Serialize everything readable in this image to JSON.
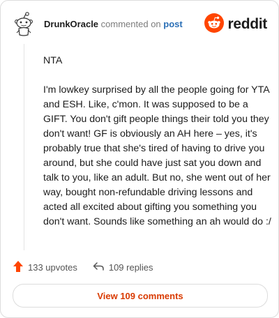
{
  "header": {
    "username": "DrunkOracle",
    "action_text": "commented on",
    "post_link": "post",
    "brand": "reddit"
  },
  "comment": {
    "paragraphs": [
      "NTA",
      "I'm lowkey surprised by all the people going for YTA and ESH. Like, c'mon. It was supposed to be a GIFT. You don't gift people things their told you they don't want! GF is obviously an AH here – yes, it's probably true that she's tired of having to drive you around, but she could have just sat you down and talk to you, like an adult. But no, she went out of her way, bought non-refundable driving lessons and acted all excited about gifting you something you don't want. Sounds like something an ah would do :/"
    ]
  },
  "actions": {
    "upvotes": "133 upvotes",
    "replies": "109 replies"
  },
  "view_comments": "View 109 comments",
  "colors": {
    "brand_orange": "#ff4500",
    "accent_text": "#d93a00",
    "link_blue": "#2a6fb6"
  },
  "icons": [
    "snoo-avatar-icon",
    "reddit-logo-icon",
    "upvote-arrow-icon",
    "reply-arrow-icon"
  ]
}
